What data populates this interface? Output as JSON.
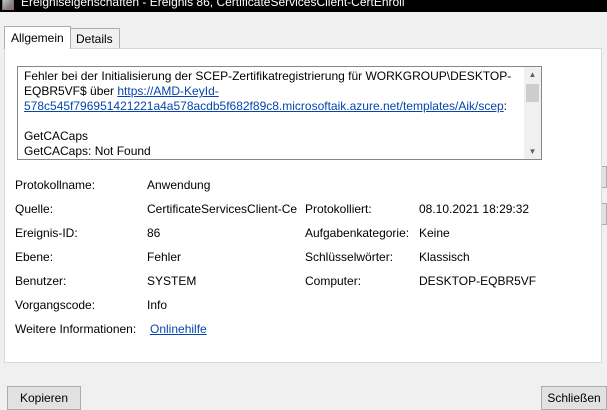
{
  "window": {
    "title": "Ereigniseigenschaften - Ereignis 86, CertificateServicesClient-CertEnroll"
  },
  "tabs": [
    {
      "label": "Allgemein"
    },
    {
      "label": "Details"
    }
  ],
  "message": {
    "line1": "Fehler bei der Initialisierung der SCEP-Zertifikatregistrierung für WORKGROUP\\DESKTOP-",
    "line2_prefix": "EQBR5VF$ über ",
    "link_part1": "https://AMD-KeyId-",
    "link_part2": "578c545f796951421221a4a578acdb5f682f89c8.microsoftaik.azure.net/templates/Aik/scep",
    "link_suffix": ":",
    "line4": "GetCACaps",
    "line5": "GetCACaps: Not Found"
  },
  "fields": {
    "protokollname": {
      "label": "Protokollname:",
      "value": "Anwendung"
    },
    "quelle": {
      "label": "Quelle:",
      "value": "CertificateServicesClient-Cer"
    },
    "protokolliert": {
      "label": "Protokolliert:",
      "value": "08.10.2021 18:29:32"
    },
    "ereignis_id": {
      "label": "Ereignis-ID:",
      "value": "86"
    },
    "aufgabenkategorie": {
      "label": "Aufgabenkategorie:",
      "value": "Keine"
    },
    "ebene": {
      "label": "Ebene:",
      "value": "Fehler"
    },
    "schluesselwoerter": {
      "label": "Schlüsselwörter:",
      "value": "Klassisch"
    },
    "benutzer": {
      "label": "Benutzer:",
      "value": "SYSTEM"
    },
    "computer": {
      "label": "Computer:",
      "value": "DESKTOP-EQBR5VF"
    },
    "vorgangscode": {
      "label": "Vorgangscode:",
      "value": "Info"
    },
    "weitere_informationen": {
      "label": "Weitere Informationen:",
      "value": "Onlinehilfe"
    }
  },
  "buttons": {
    "copy": "Kopieren",
    "close": "Schließen"
  },
  "icons": {
    "up": "arrow-up-icon",
    "down": "arrow-down-icon"
  }
}
